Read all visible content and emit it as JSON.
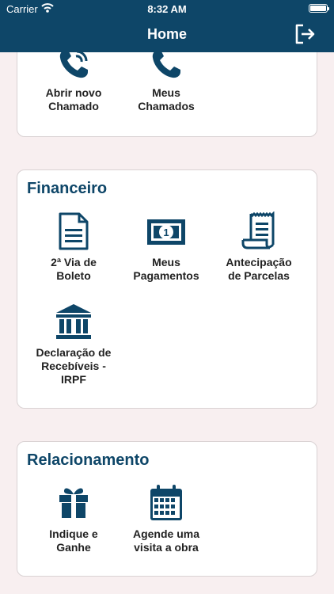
{
  "status_bar": {
    "carrier": "Carrier",
    "time": "8:32 AM"
  },
  "header": {
    "title": "Home"
  },
  "icons": {
    "logout": "logout-icon",
    "phone_ring": "phone-ringing-icon",
    "phone": "phone-icon",
    "document": "document-icon",
    "money": "money-bill-icon",
    "receipt": "receipt-icon",
    "bank": "bank-icon",
    "gift": "gift-icon",
    "calendar": "calendar-icon"
  },
  "colors": {
    "primary": "#0e4668",
    "background": "#f8eff0",
    "card": "#ffffff"
  },
  "support": {
    "items": [
      {
        "label": "Abrir novo\nChamado"
      },
      {
        "label": "Meus\nChamados"
      }
    ]
  },
  "financeiro": {
    "title": "Financeiro",
    "items": [
      {
        "label": "2ª Via de\nBoleto"
      },
      {
        "label": "Meus\nPagamentos"
      },
      {
        "label": "Antecipação\nde Parcelas"
      },
      {
        "label": "Declaração de\nRecebíveis -\nIRPF"
      }
    ]
  },
  "relacionamento": {
    "title": "Relacionamento",
    "items": [
      {
        "label": "Indique e\nGanhe"
      },
      {
        "label": "Agende uma\nvisita a obra"
      }
    ]
  }
}
